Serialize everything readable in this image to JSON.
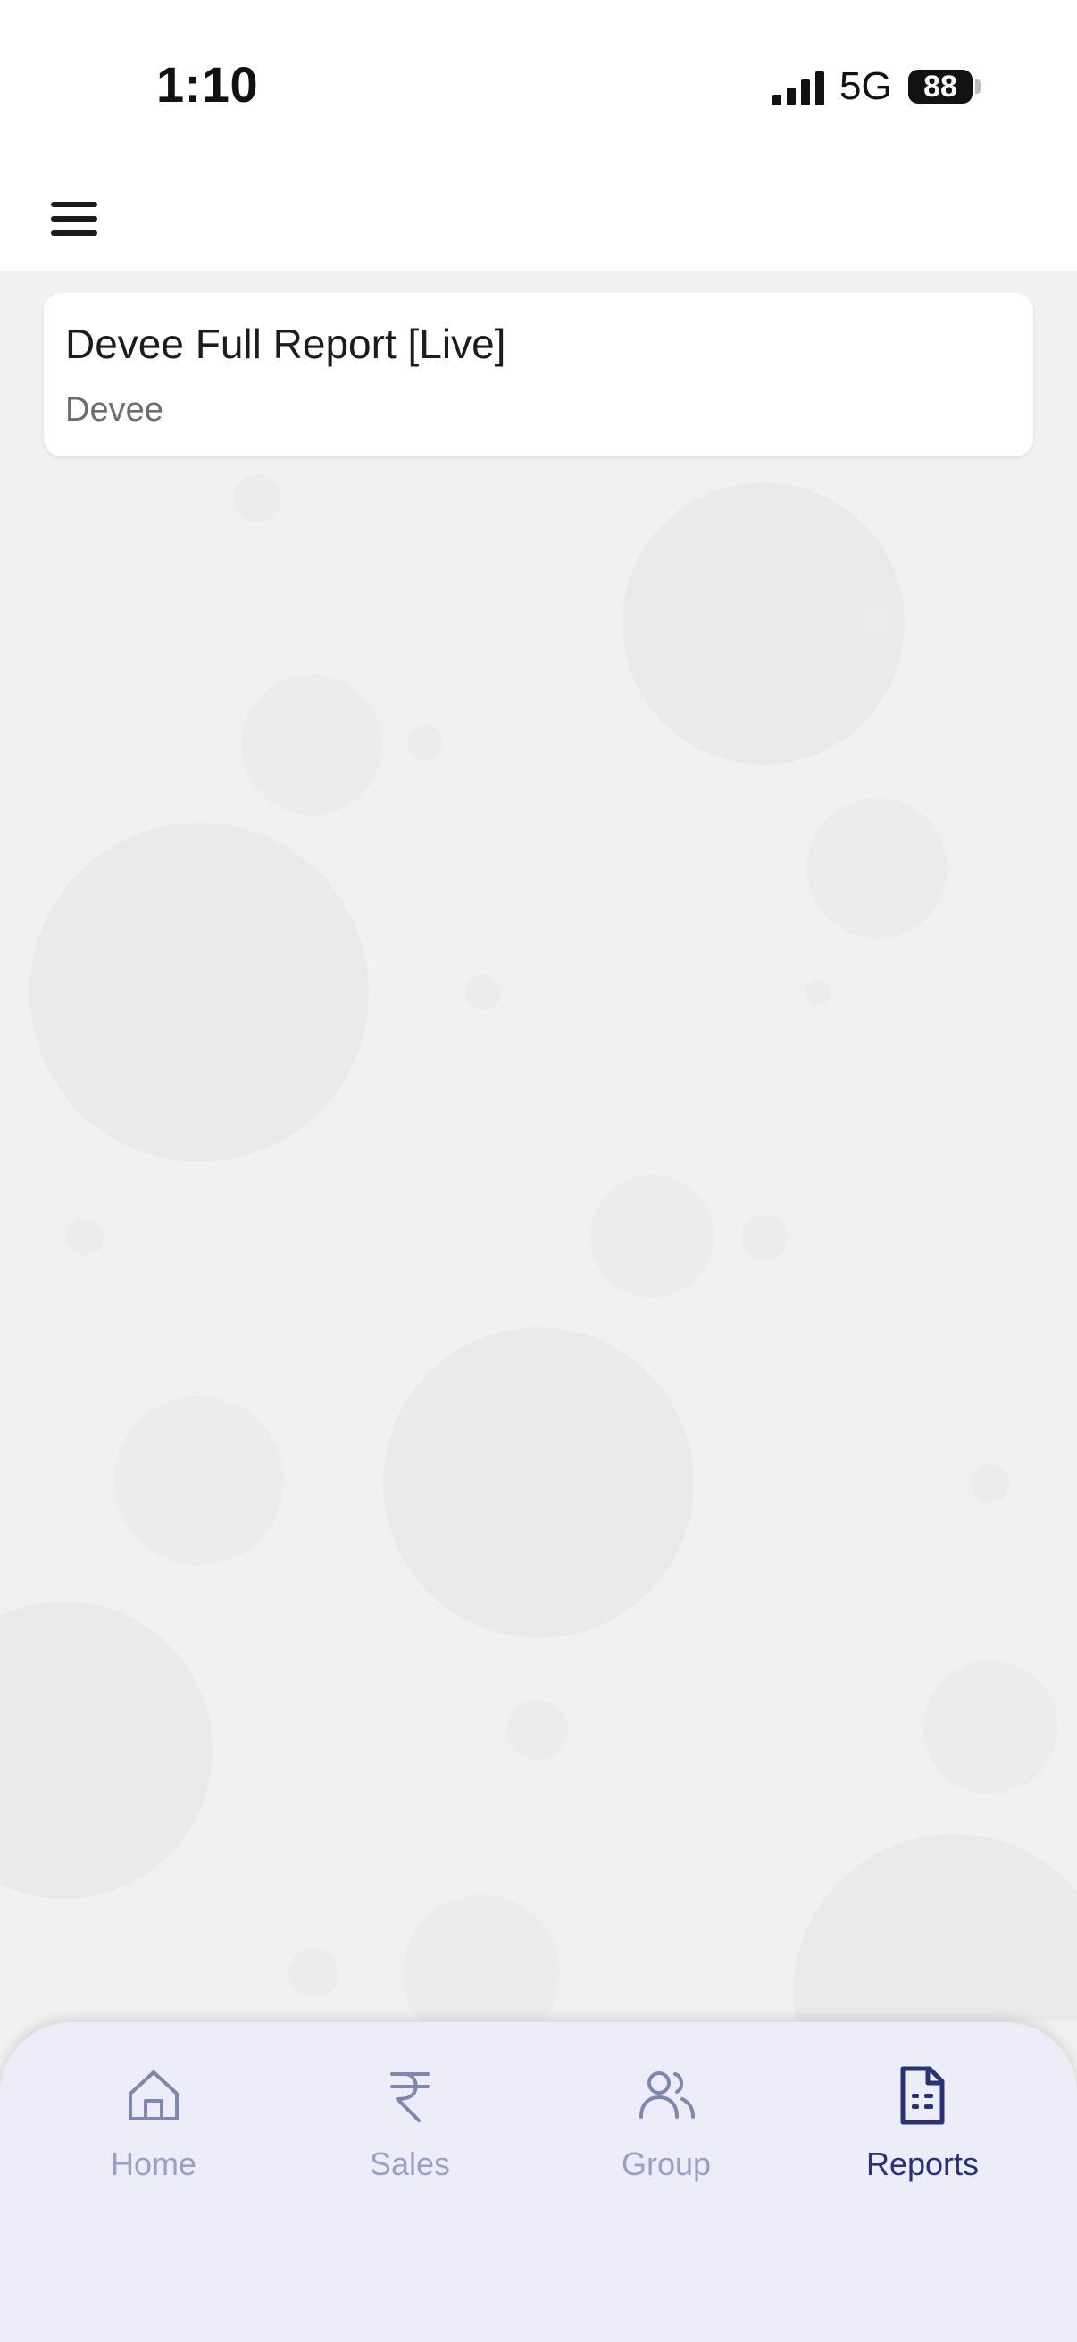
{
  "status_bar": {
    "time": "1:10",
    "network": "5G",
    "battery": "88"
  },
  "app_bar": {
    "menu_icon": "hamburger-menu-icon"
  },
  "reports": [
    {
      "title": "Devee Full Report [Live]",
      "subtitle": "Devee"
    }
  ],
  "bottom_nav": {
    "items": [
      {
        "label": "Home",
        "icon": "home-icon",
        "active": false
      },
      {
        "label": "Sales",
        "icon": "rupee-icon",
        "active": false
      },
      {
        "label": "Group",
        "icon": "group-icon",
        "active": false
      },
      {
        "label": "Reports",
        "icon": "report-document-icon",
        "active": true
      }
    ]
  },
  "colors": {
    "active": "#2a3275",
    "inactive": "#9aa0c2",
    "nav_background": "#ecedf8",
    "page_background": "#f1f1f1"
  }
}
